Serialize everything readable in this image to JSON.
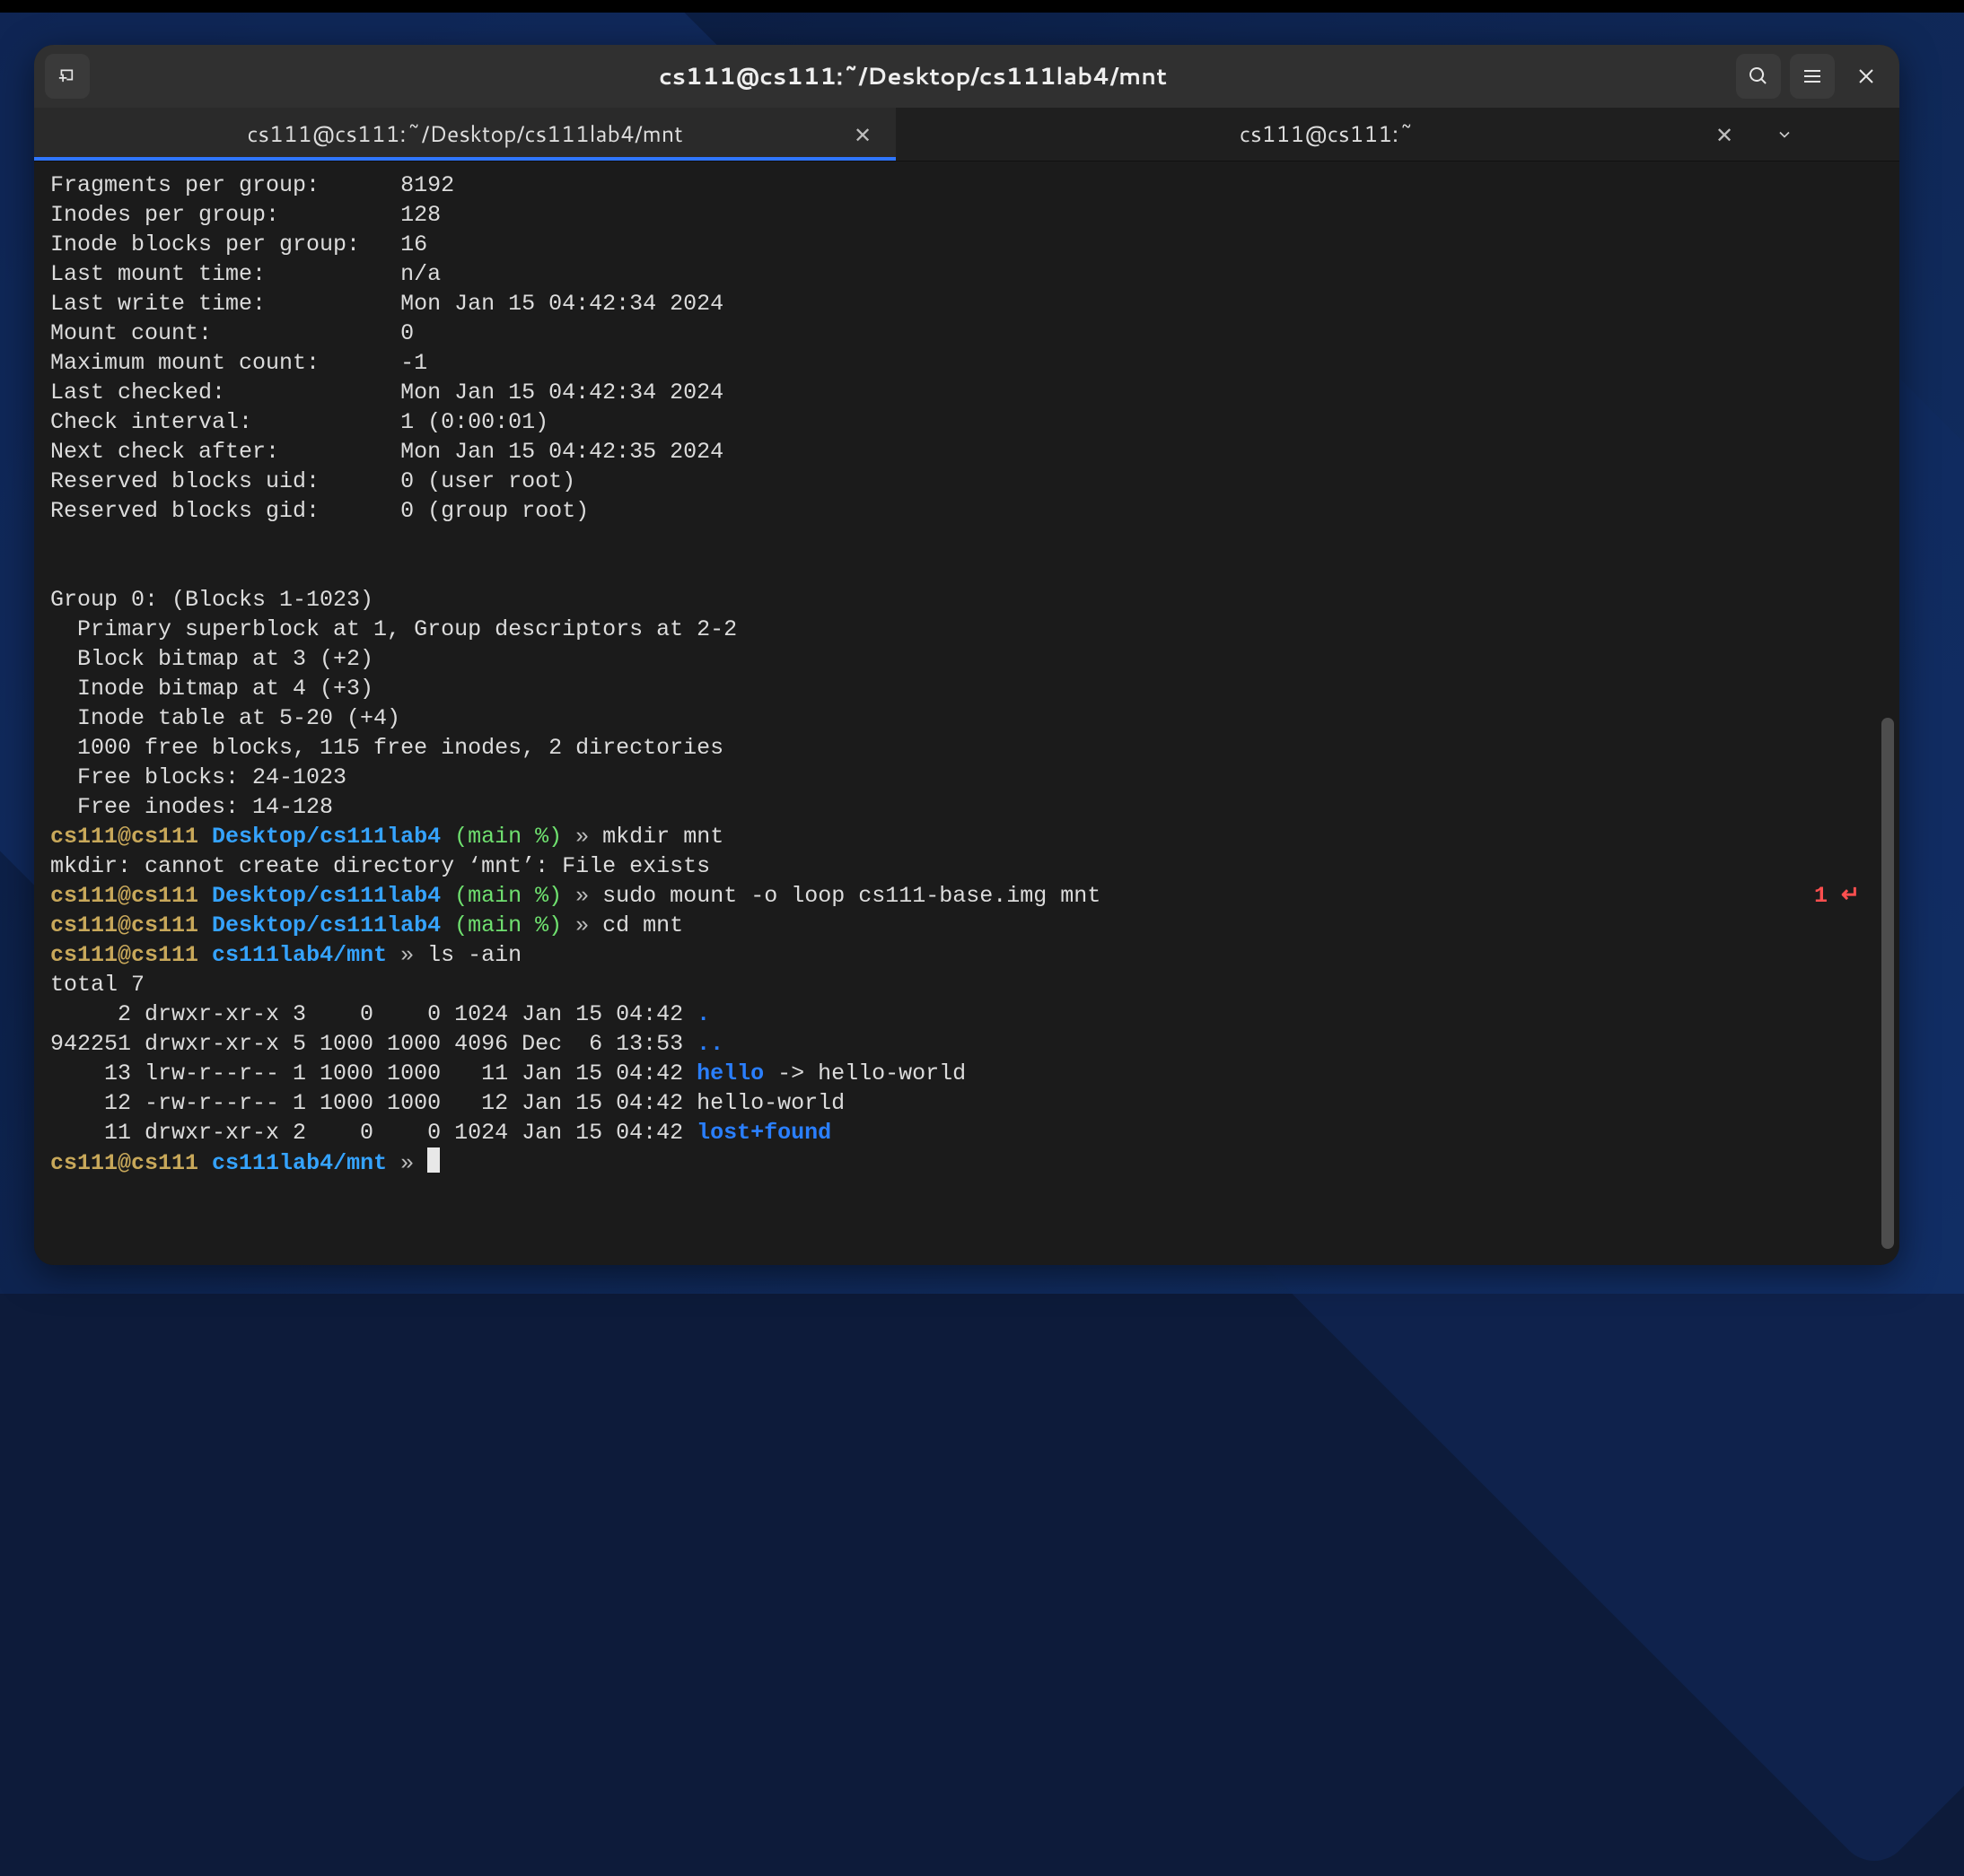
{
  "window": {
    "title": "cs111@cs111:~/Desktop/cs111lab4/mnt"
  },
  "tabs": [
    {
      "label": "cs111@cs111:~/Desktop/cs111lab4/mnt",
      "active": true
    },
    {
      "label": "cs111@cs111:~",
      "active": false
    }
  ],
  "fs_stats": [
    {
      "label": "Fragments per group:",
      "value": "8192"
    },
    {
      "label": "Inodes per group:",
      "value": "128"
    },
    {
      "label": "Inode blocks per group:",
      "value": "16"
    },
    {
      "label": "Last mount time:",
      "value": "n/a"
    },
    {
      "label": "Last write time:",
      "value": "Mon Jan 15 04:42:34 2024"
    },
    {
      "label": "Mount count:",
      "value": "0"
    },
    {
      "label": "Maximum mount count:",
      "value": "-1"
    },
    {
      "label": "Last checked:",
      "value": "Mon Jan 15 04:42:34 2024"
    },
    {
      "label": "Check interval:",
      "value": "1 (0:00:01)"
    },
    {
      "label": "Next check after:",
      "value": "Mon Jan 15 04:42:35 2024"
    },
    {
      "label": "Reserved blocks uid:",
      "value": "0 (user root)"
    },
    {
      "label": "Reserved blocks gid:",
      "value": "0 (group root)"
    }
  ],
  "group0": {
    "header": "Group 0: (Blocks 1-1023)",
    "lines": [
      "Primary superblock at 1, Group descriptors at 2-2",
      "Block bitmap at 3 (+2)",
      "Inode bitmap at 4 (+3)",
      "Inode table at 5-20 (+4)",
      "1000 free blocks, 115 free inodes, 2 directories",
      "Free blocks: 24-1023",
      "Free inodes: 14-128"
    ]
  },
  "prompts": {
    "hostuser": "cs111@cs111",
    "path_lab": "Desktop/cs111lab4",
    "path_mnt": "cs111lab4/mnt",
    "branch": "(main %)",
    "sep": "»"
  },
  "lines": {
    "cmd_mkdir": "mkdir mnt",
    "mkdir_err": "mkdir: cannot create directory ‘mnt’: File exists",
    "rc_badge": "1 ↵",
    "cmd_mount": "sudo mount -o loop cs111-base.img mnt",
    "cmd_cd": "cd mnt",
    "cmd_ls": "ls -ain",
    "ls_total": "total 7"
  },
  "ls_rows": [
    {
      "inode": "     2",
      "mode": "drwxr-xr-x",
      "n": "3",
      "uid": "   0",
      "gid": "   0",
      "size": "1024",
      "date": "Jan 15 04:42",
      "name": ".",
      "name_color": "dir",
      "suffix": ""
    },
    {
      "inode": "942251",
      "mode": "drwxr-xr-x",
      "n": "5",
      "uid": "1000",
      "gid": "1000",
      "size": "4096",
      "date": "Dec  6 13:53",
      "name": "..",
      "name_color": "dir",
      "suffix": ""
    },
    {
      "inode": "    13",
      "mode": "lrw-r--r--",
      "n": "1",
      "uid": "1000",
      "gid": "1000",
      "size": "  11",
      "date": "Jan 15 04:42",
      "name": "hello",
      "name_color": "dir",
      "suffix": " -> hello-world"
    },
    {
      "inode": "    12",
      "mode": "-rw-r--r--",
      "n": "1",
      "uid": "1000",
      "gid": "1000",
      "size": "  12",
      "date": "Jan 15 04:42",
      "name": "hello-world",
      "name_color": "",
      "suffix": ""
    },
    {
      "inode": "    11",
      "mode": "drwxr-xr-x",
      "n": "2",
      "uid": "   0",
      "gid": "   0",
      "size": "1024",
      "date": "Jan 15 04:42",
      "name": "lost+found",
      "name_color": "dir",
      "suffix": ""
    }
  ]
}
